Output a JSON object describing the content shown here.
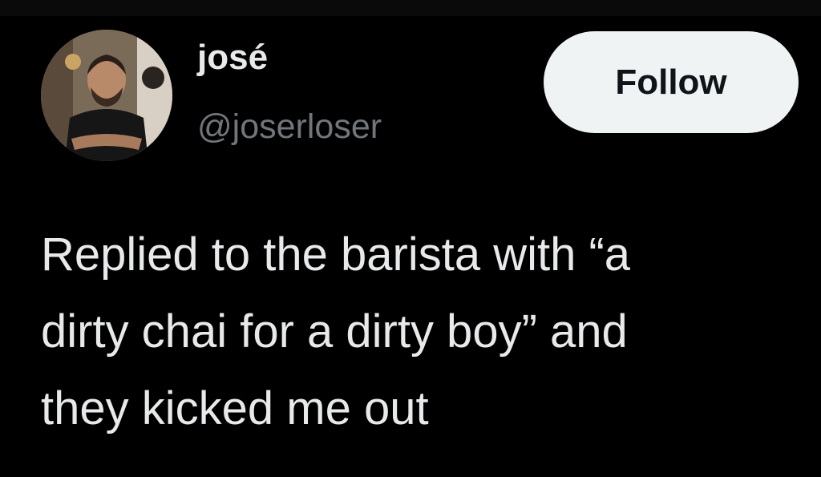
{
  "tweet": {
    "author": {
      "display_name": "josé",
      "handle": "@joserloser",
      "avatar_icon": "profile-photo"
    },
    "follow_label": "Follow",
    "text": "Replied to the barista with “a\ndirty chai for a dirty boy” and\nthey kicked me out"
  },
  "colors": {
    "background": "#000000",
    "primary_text": "#e7e9ea",
    "secondary_text": "#71767b",
    "follow_button_bg": "#eff3f4",
    "follow_button_text": "#0f1419"
  }
}
